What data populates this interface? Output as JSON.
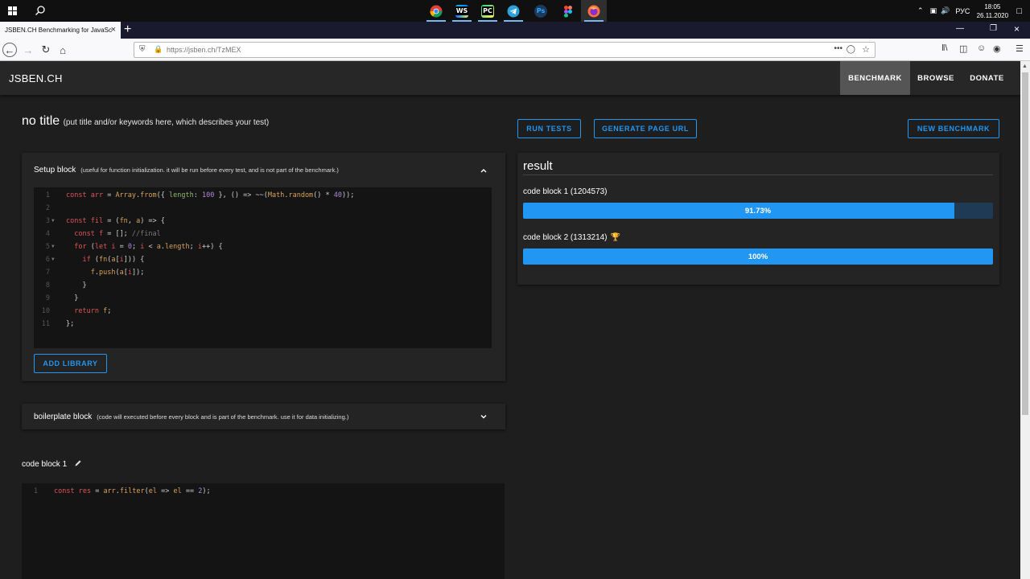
{
  "taskbar": {
    "apps": [
      {
        "name": "chrome-icon",
        "color": "#e33b2e",
        "glyph": "",
        "active": false
      },
      {
        "name": "webstorm-icon",
        "color": "#0a7bbf",
        "glyph": "WS",
        "active": false
      },
      {
        "name": "pycharm-icon",
        "color": "#21d789",
        "glyph": "PC",
        "active": false
      },
      {
        "name": "telegram-icon",
        "color": "#2aa1da",
        "glyph": "",
        "active": false
      },
      {
        "name": "photoshop-icon",
        "color": "#1c3a5e",
        "glyph": "Ps",
        "active": false
      },
      {
        "name": "figma-icon",
        "color": "#f24e1e",
        "glyph": "",
        "active": false
      },
      {
        "name": "firefox-icon",
        "color": "#ff7139",
        "glyph": "",
        "active": true
      }
    ],
    "lang": "РУС",
    "time": "18:05",
    "date": "26.11.2020"
  },
  "browser": {
    "tab_title": "JSBEN.CH Benchmarking for JavaSc",
    "url": "https://jsben.ch/TzMEX"
  },
  "site": {
    "logo": "JSBEN.CH",
    "nav": [
      {
        "label": "BENCHMARK",
        "active": true
      },
      {
        "label": "BROWSE",
        "active": false
      },
      {
        "label": "DONATE",
        "active": false
      }
    ]
  },
  "page": {
    "title": "no title",
    "title_hint": "(put title and/or keywords here, which describes your test)"
  },
  "buttons": {
    "run_tests": "RUN TESTS",
    "generate_url": "GENERATE PAGE URL",
    "new_benchmark": "NEW BENCHMARK",
    "add_library": "ADD LIBRARY"
  },
  "setup_block": {
    "title": "Setup block",
    "hint": "(useful for function initialization. it will be run before every test, and is not part of the benchmark.)",
    "line_numbers": [
      "1",
      "2",
      "3",
      "4",
      "5",
      "6",
      "7",
      "8",
      "9",
      "10",
      "11"
    ]
  },
  "boilerplate_block": {
    "title": "boilerplate block",
    "hint": "(code will executed before every block and is part of the benchmark. use it for data initializing.)"
  },
  "code_block_1": {
    "title": "code block 1",
    "line_numbers": [
      "1"
    ]
  },
  "result": {
    "title": "result",
    "items": [
      {
        "label": "code block 1 (1204573)",
        "percent_label": "91.73%",
        "fraction": 0.9173,
        "winner": false
      },
      {
        "label": "code block 2 (1313214)",
        "percent_label": "100%",
        "fraction": 1.0,
        "winner": true
      }
    ]
  },
  "colors": {
    "accent": "#2196f3",
    "track": "#1e3a55",
    "header": "#272727",
    "background": "#1e1e1e"
  }
}
